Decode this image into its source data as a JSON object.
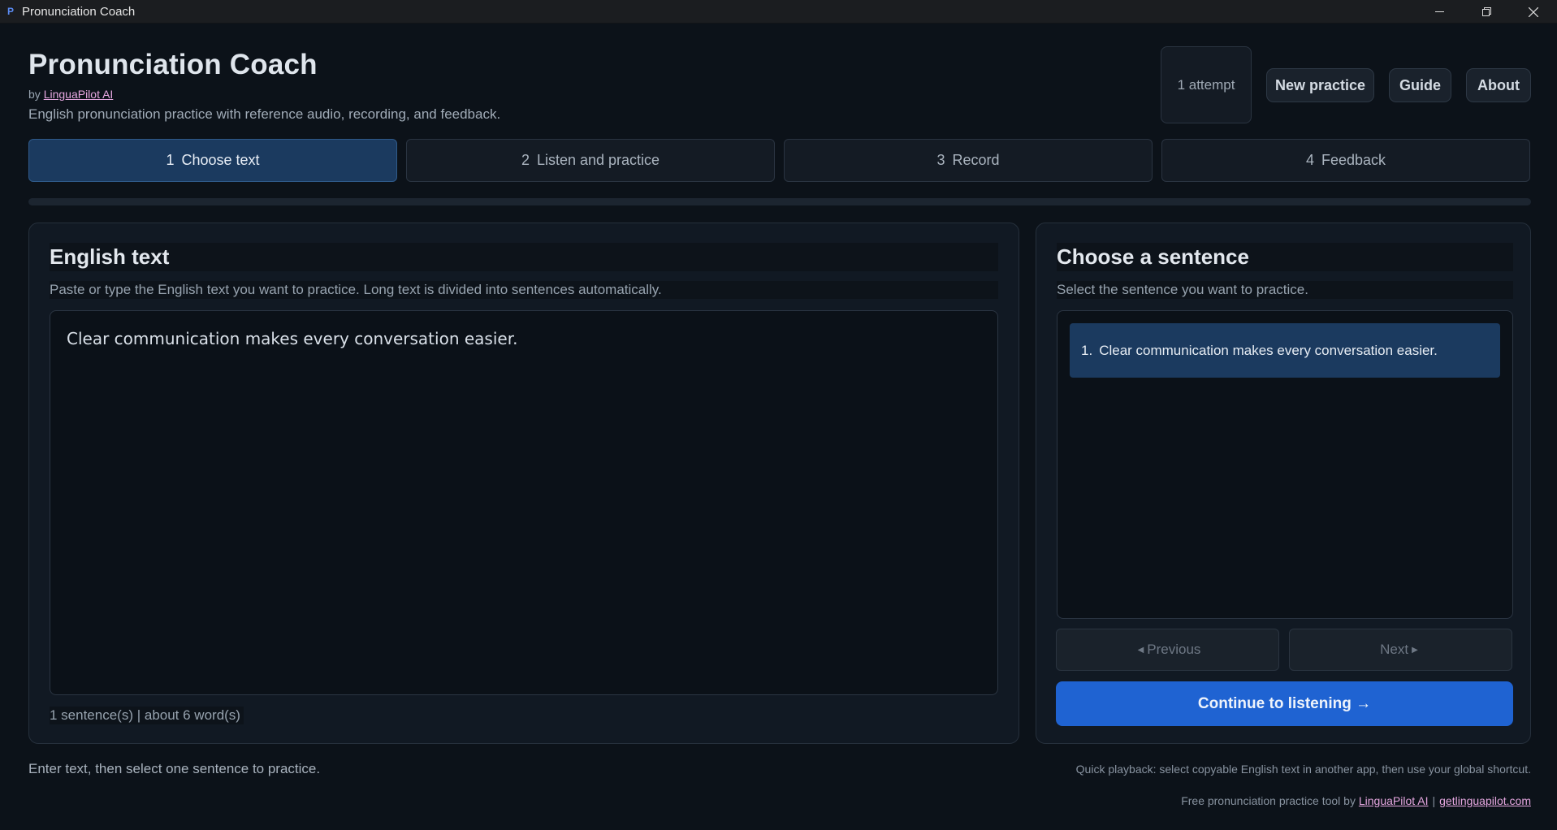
{
  "window": {
    "icon_letter": "P",
    "title": "Pronunciation Coach"
  },
  "header": {
    "title": "Pronunciation Coach",
    "by_prefix": "by",
    "by_link": "LinguaPilot AI",
    "subtitle": "English pronunciation practice with reference audio, recording, and feedback.",
    "attempts": "1 attempt",
    "buttons": {
      "new_practice": "New practice",
      "guide": "Guide",
      "about": "About"
    }
  },
  "steps": [
    {
      "num": "1",
      "label": "Choose text",
      "active": true
    },
    {
      "num": "2",
      "label": "Listen and practice",
      "active": false
    },
    {
      "num": "3",
      "label": "Record",
      "active": false
    },
    {
      "num": "4",
      "label": "Feedback",
      "active": false
    }
  ],
  "left_panel": {
    "heading": "English text",
    "description": "Paste or type the English text you want to practice. Long text is divided into sentences automatically.",
    "text_value": "Clear communication makes every conversation easier.",
    "counts": "1 sentence(s) | about 6 word(s)"
  },
  "right_panel": {
    "heading": "Choose a sentence",
    "description": "Select the sentence you want to practice.",
    "sentences": [
      {
        "index": "1.",
        "text": "Clear communication makes every conversation easier."
      }
    ],
    "previous": "Previous",
    "next": "Next",
    "continue": "Continue to listening →"
  },
  "footer": {
    "status": "Enter text, then select one sentence to practice.",
    "quick_playback": "Quick playback: select copyable English text in another app, then use your global shortcut.",
    "credit_prefix": "Free pronunciation practice tool by",
    "credit_link": "LinguaPilot AI",
    "separator": "|",
    "site_link": "getlinguapilot.com"
  },
  "colors": {
    "accent": "#1f63d2",
    "active_step": "#1b3a5f",
    "background": "#0c1219",
    "link": "#e6a7e0"
  }
}
